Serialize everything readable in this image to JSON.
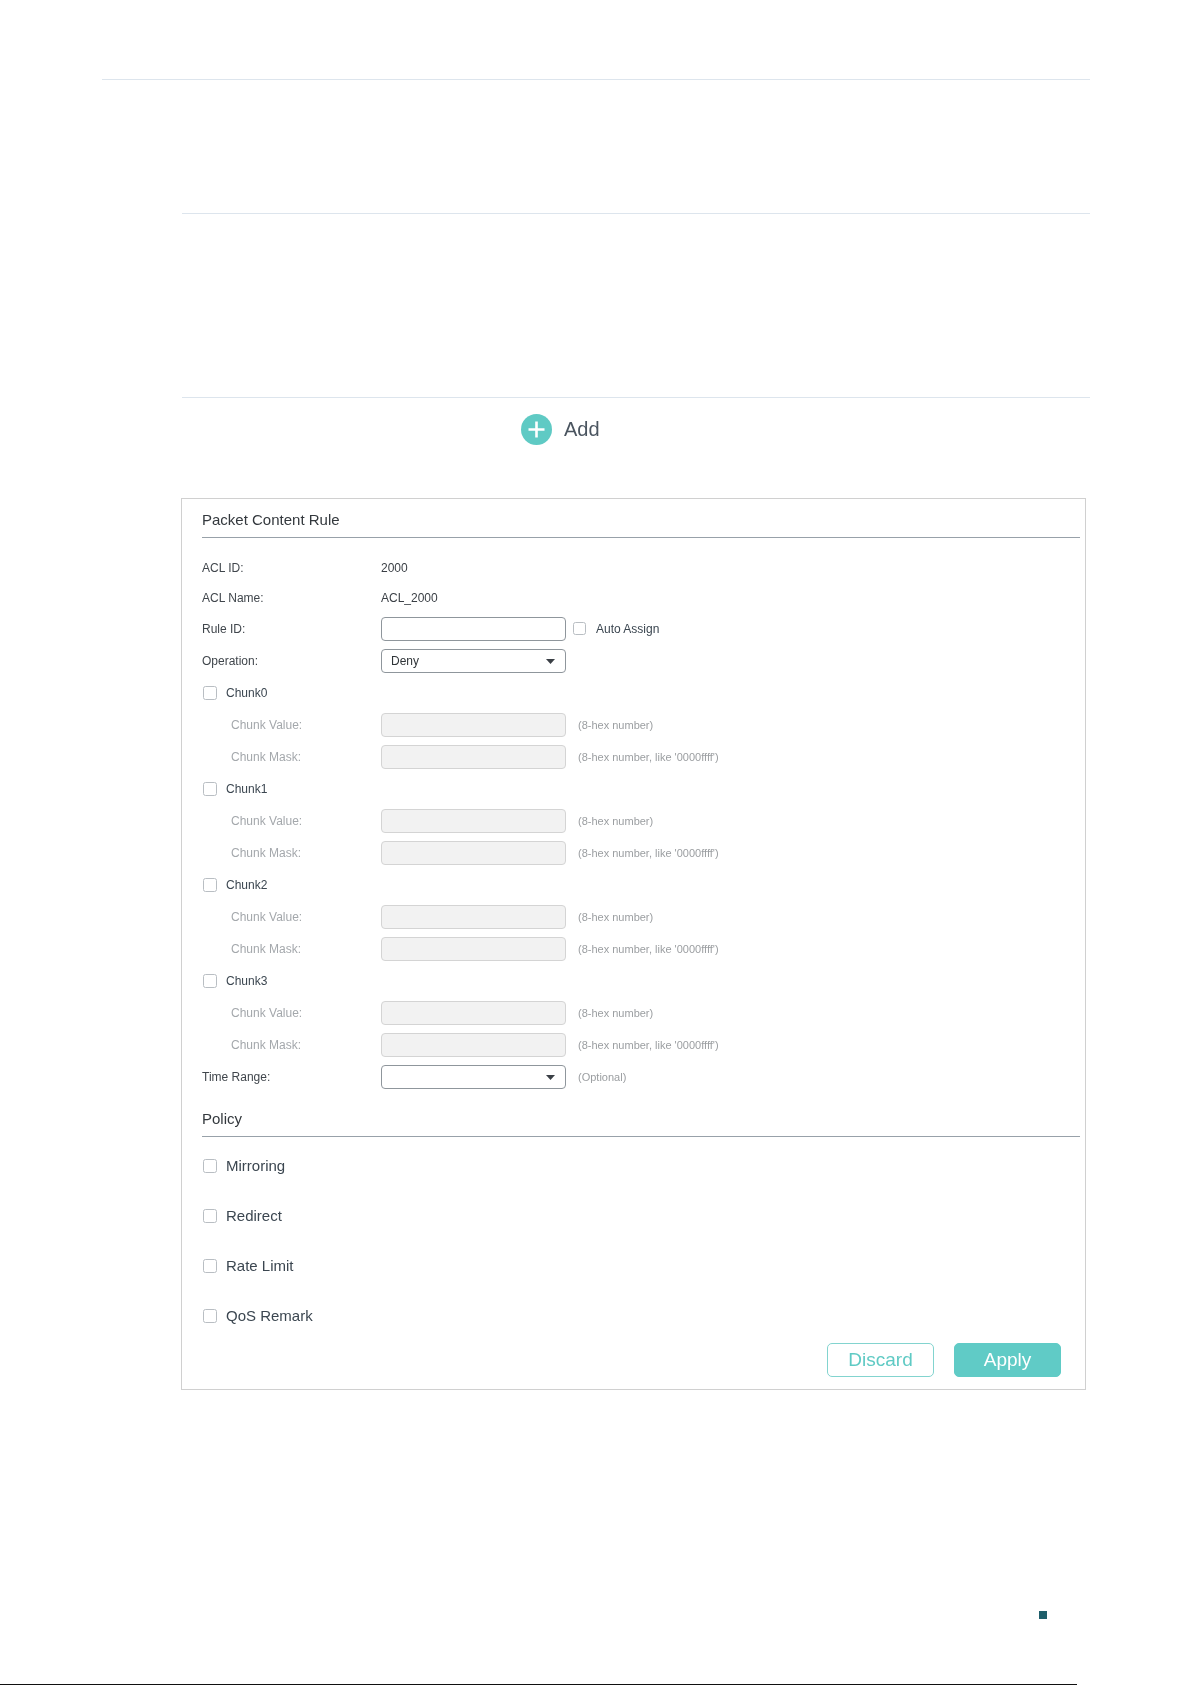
{
  "add_button": {
    "label": "Add"
  },
  "form": {
    "title": "Packet Content Rule",
    "rows": [
      {
        "kind": "static",
        "label": "ACL ID:",
        "value": "2000"
      },
      {
        "kind": "static",
        "label": "ACL Name:",
        "value": "ACL_2000"
      },
      {
        "kind": "input",
        "label": "Rule ID:",
        "disabled": false,
        "option": {
          "label": "Auto Assign",
          "checked": false
        }
      },
      {
        "kind": "select",
        "label": "Operation:",
        "value": "Deny"
      },
      {
        "kind": "checkbox",
        "label": "Chunk0",
        "checked": false,
        "children": [
          {
            "kind": "input",
            "label": "Chunk Value:",
            "disabled": true,
            "hint": "(8-hex number)"
          },
          {
            "kind": "input",
            "label": "Chunk Mask:",
            "disabled": true,
            "hint": "(8-hex number, like '0000ffff')"
          }
        ]
      },
      {
        "kind": "checkbox",
        "label": "Chunk1",
        "checked": false,
        "children": [
          {
            "kind": "input",
            "label": "Chunk Value:",
            "disabled": true,
            "hint": "(8-hex number)"
          },
          {
            "kind": "input",
            "label": "Chunk Mask:",
            "disabled": true,
            "hint": "(8-hex number, like '0000ffff')"
          }
        ]
      },
      {
        "kind": "checkbox",
        "label": "Chunk2",
        "checked": false,
        "children": [
          {
            "kind": "input",
            "label": "Chunk Value:",
            "disabled": true,
            "hint": "(8-hex number)"
          },
          {
            "kind": "input",
            "label": "Chunk Mask:",
            "disabled": true,
            "hint": "(8-hex number, like '0000ffff')"
          }
        ]
      },
      {
        "kind": "checkbox",
        "label": "Chunk3",
        "checked": false,
        "children": [
          {
            "kind": "input",
            "label": "Chunk Value:",
            "disabled": true,
            "hint": "(8-hex number)"
          },
          {
            "kind": "input",
            "label": "Chunk Mask:",
            "disabled": true,
            "hint": "(8-hex number, like '0000ffff')"
          }
        ]
      },
      {
        "kind": "select",
        "label": "Time Range:",
        "hint": "(Optional)"
      }
    ]
  },
  "policy": {
    "title": "Policy",
    "options": [
      {
        "label": "Mirroring",
        "checked": false
      },
      {
        "label": "Redirect",
        "checked": false
      },
      {
        "label": "Rate Limit",
        "checked": false
      },
      {
        "label": "QoS Remark",
        "checked": false
      }
    ]
  },
  "buttons": [
    {
      "kind": "secondary",
      "label": "Discard"
    },
    {
      "kind": "primary",
      "label": "Apply"
    }
  ]
}
